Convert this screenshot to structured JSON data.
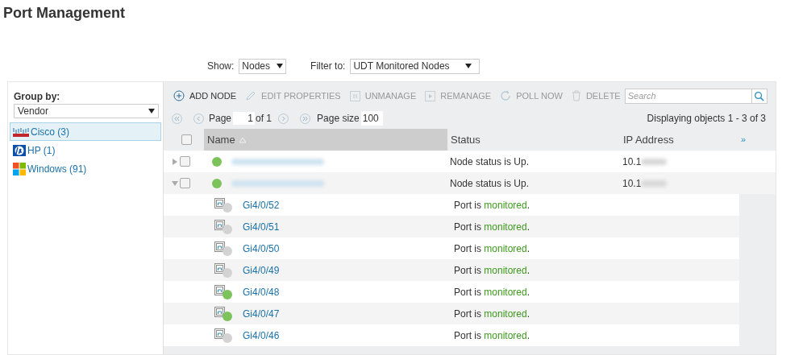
{
  "page_title": "Port Management",
  "show": {
    "label": "Show:",
    "value": "Nodes"
  },
  "filter": {
    "label": "Filter to:",
    "value": "UDT Monitored Nodes"
  },
  "group_by": {
    "label": "Group by:",
    "value": "Vendor"
  },
  "vendors": [
    {
      "kind": "cisco",
      "label": "Cisco (3)",
      "selected": true
    },
    {
      "kind": "hp",
      "label": "HP (1)",
      "selected": false
    },
    {
      "kind": "windows",
      "label": "Windows (91)",
      "selected": false
    }
  ],
  "toolbar": [
    {
      "kind": "add",
      "label": "ADD NODE",
      "disabled": false
    },
    {
      "kind": "edit",
      "label": "EDIT PROPERTIES",
      "disabled": true
    },
    {
      "kind": "unmanage",
      "label": "UNMANAGE",
      "disabled": true
    },
    {
      "kind": "remanage",
      "label": "REMANAGE",
      "disabled": true
    },
    {
      "kind": "poll",
      "label": "POLL NOW",
      "disabled": true
    },
    {
      "kind": "delete",
      "label": "DELETE",
      "disabled": true
    }
  ],
  "search": {
    "placeholder": "Search"
  },
  "pager": {
    "page_label": "Page",
    "page": "1",
    "of": "of 1",
    "size_label": "Page size",
    "size": "100",
    "summary": "Displaying objects 1 - 3 of 3"
  },
  "select_all": {
    "checked": false
  },
  "columns": [
    {
      "label": "Name",
      "sorted": true
    },
    {
      "label": "Status",
      "sorted": false
    },
    {
      "label": "IP Address",
      "sorted": false
    }
  ],
  "more_columns": "»",
  "nodes": [
    {
      "expanded": false,
      "checked": false,
      "status": "Node status is Up.",
      "ip": "10.1",
      "color": "#7dc35b"
    },
    {
      "expanded": true,
      "checked": false,
      "status": "Node status is Up.",
      "ip": "10.1",
      "color": "#7dc35b"
    }
  ],
  "ports": [
    {
      "name": "Gi4/0/52",
      "color": "#d3d3d3",
      "status_prefix": "Port is ",
      "status_word": "monitored",
      "status_suffix": "."
    },
    {
      "name": "Gi4/0/51",
      "color": "#d3d3d3",
      "status_prefix": "Port is ",
      "status_word": "monitored",
      "status_suffix": "."
    },
    {
      "name": "Gi4/0/50",
      "color": "#d3d3d3",
      "status_prefix": "Port is ",
      "status_word": "monitored",
      "status_suffix": "."
    },
    {
      "name": "Gi4/0/49",
      "color": "#d3d3d3",
      "status_prefix": "Port is ",
      "status_word": "monitored",
      "status_suffix": "."
    },
    {
      "name": "Gi4/0/48",
      "color": "#7dc35b",
      "status_prefix": "Port is ",
      "status_word": "monitored",
      "status_suffix": "."
    },
    {
      "name": "Gi4/0/47",
      "color": "#7dc35b",
      "status_prefix": "Port is ",
      "status_word": "monitored",
      "status_suffix": "."
    },
    {
      "name": "Gi4/0/46",
      "color": "#d3d3d3",
      "status_prefix": "Port is ",
      "status_word": "monitored",
      "status_suffix": "."
    }
  ]
}
